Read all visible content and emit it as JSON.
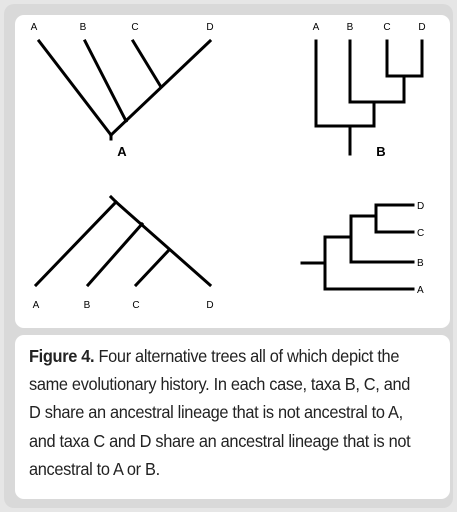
{
  "figure": {
    "trees": [
      {
        "id": "top-left",
        "label": "A",
        "taxa": [
          "A",
          "B",
          "C",
          "D"
        ]
      },
      {
        "id": "top-right",
        "label": "B",
        "taxa": [
          "A",
          "B",
          "C",
          "D"
        ]
      },
      {
        "id": "bottom-left",
        "label": "",
        "taxa": [
          "A",
          "B",
          "C",
          "D"
        ]
      },
      {
        "id": "bottom-right",
        "label": "",
        "taxa": [
          "D",
          "C",
          "B",
          "A"
        ]
      }
    ],
    "caption": {
      "label": "Figure 4.",
      "text": " Four alternative trees all of which depict the same evolutionary history. In each case, taxa B, C, and D share an ancestral lineage that is not ancestral to A, and taxa C and D share an ancestral lineage that is not ancestral to A or B."
    },
    "colors": {
      "line": "#000000",
      "panel": "#ffffff",
      "frame": "#d9d9d9",
      "caption_text": "#222222"
    }
  }
}
